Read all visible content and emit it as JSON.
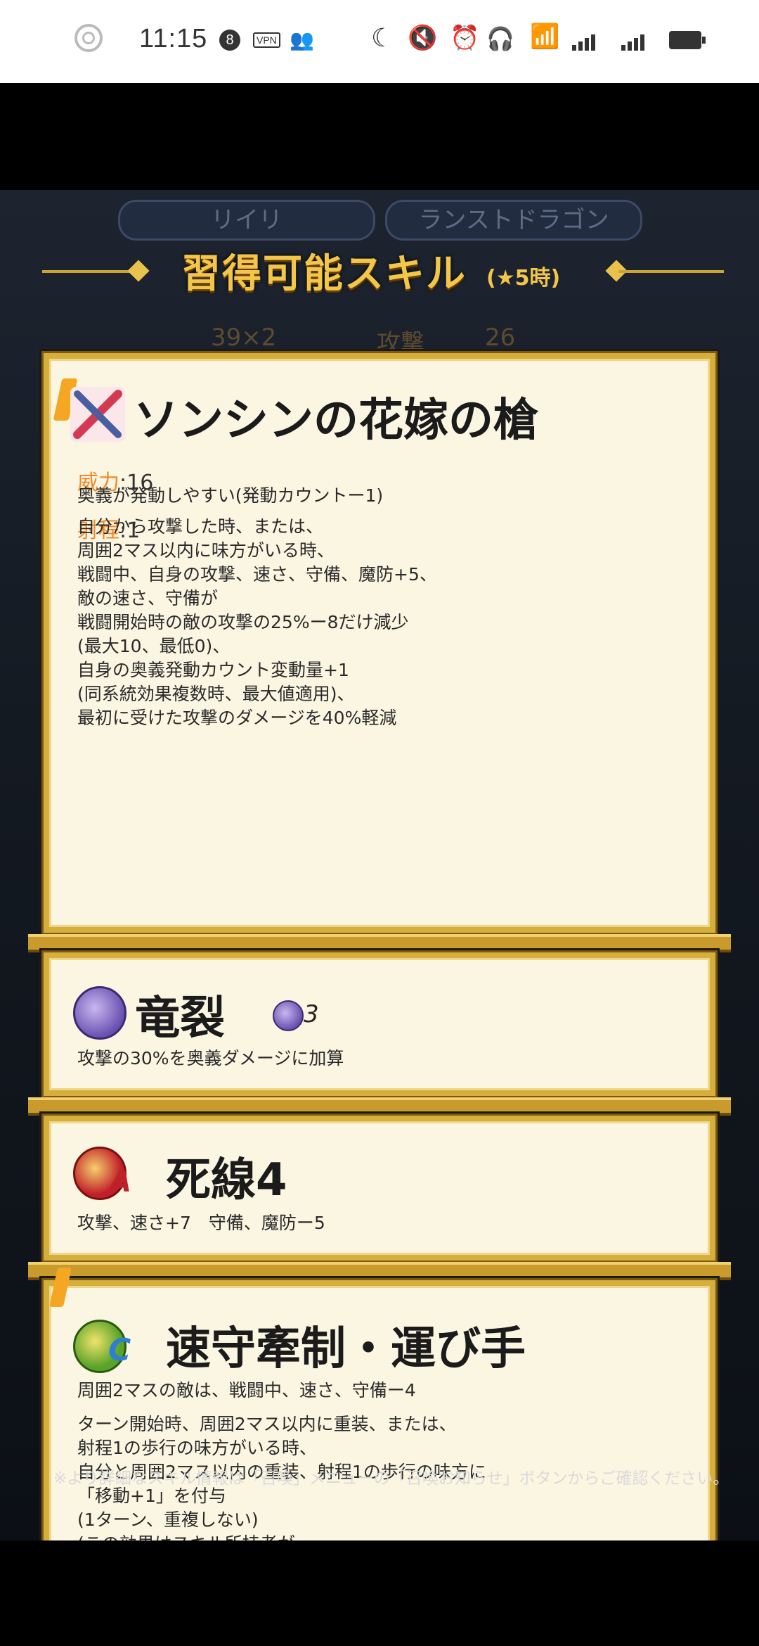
{
  "status": {
    "time": "11:15",
    "notif_count": "8",
    "vpn": "VPN"
  },
  "header": {
    "title": "習得可能スキル",
    "subtitle": "(★5時)"
  },
  "bg": {
    "tab1": "リイリ",
    "tab2": "ランストドラゴン",
    "stat1": "39×2",
    "stat2": "攻撃",
    "stat3": "26"
  },
  "weapon": {
    "name": "ソンシンの花嫁の槍",
    "might_label": "威力",
    "might_value": ":16",
    "range_label": "射程",
    "range_value": ":1",
    "line1": "奥義が発動しやすい(発動カウントー1)",
    "description": "自分から攻撃した時、または、\n周囲2マス以内に味方がいる時、\n戦闘中、自身の攻撃、速さ、守備、魔防+5、\n敵の速さ、守備が\n戦闘開始時の敵の攻撃の25%ー8だけ減少\n(最大10、最低0)、\n自身の奥義発動カウント変動量+1\n(同系統効果複数時、最大値適用)、\n最初に受けた攻撃のダメージを40%軽減"
  },
  "special": {
    "name": "竜裂",
    "cooldown": "3",
    "description": "攻撃の30%を奥義ダメージに加算"
  },
  "skill_a": {
    "name": "死線4",
    "letter": "A",
    "description": "攻撃、速さ+7　守備、魔防ー5"
  },
  "skill_c": {
    "name": "速守牽制・運び手",
    "letter": "C",
    "line1": "周囲2マスの敵は、戦闘中、速さ、守備ー4",
    "description": "ターン開始時、周囲2マス以内に重装、または、\n射程1の歩行の味方がいる時、\n自分と周囲2マス以内の重装、射程1の歩行の味方に\n「移動+1」を付与\n(1ターン、重複しない)\n(この効果はスキル所持者が\n「歌う」「踊る」スキルを装備していない時のみ発動)"
  },
  "footer": {
    "note": "※より詳細なスキル情報は「召喚」メニューの「召喚お知らせ」ボタンからご確認ください。"
  },
  "colors": {
    "gold": "#d5ae3c",
    "card_bg": "#fbf6e2",
    "orange_label": "#f0892a",
    "special_purple": "#6a4fb0",
    "skill_a_red": "#c0202a",
    "skill_c_green": "#5aa32a"
  }
}
